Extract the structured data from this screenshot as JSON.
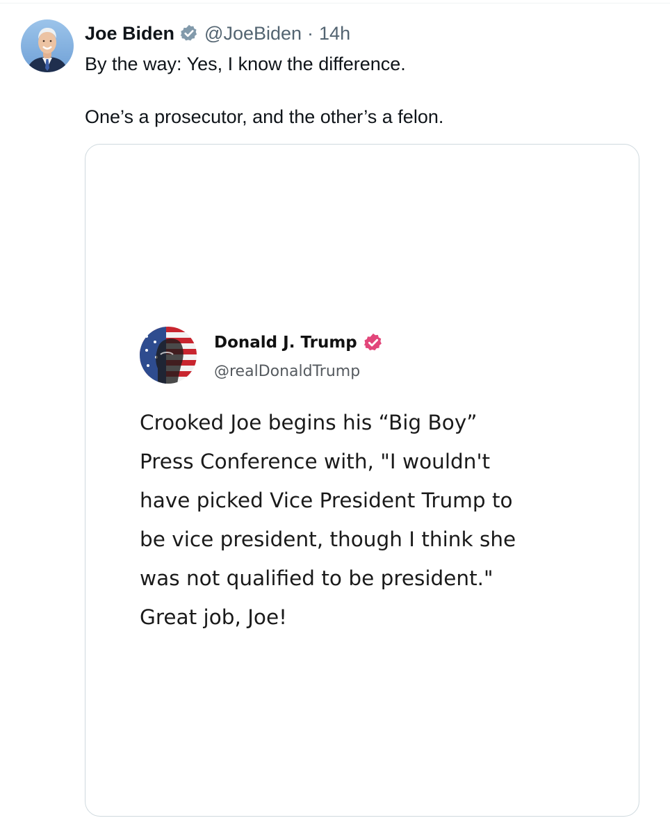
{
  "tweet": {
    "author": {
      "name": "Joe Biden",
      "handle": "@JoeBiden",
      "verified_badge_color": "#829aab",
      "avatar_icon": "joe-biden-avatar"
    },
    "separator": "·",
    "timestamp": "14h",
    "text_line_1": "By the way: Yes, I know the difference.",
    "text_line_2": "One’s a prosecutor, and the other’s a felon."
  },
  "embedded_post": {
    "author": {
      "name": "Donald J. Trump",
      "handle": "@realDonaldTrump",
      "verified_badge_color": "#e2467a",
      "avatar_icon": "donald-trump-flag-avatar"
    },
    "text": "Crooked Joe begins his “Big Boy”\nPress Conference with, \"I wouldn't\nhave picked Vice President Trump to\nbe vice president, though I think she\nwas not qualified to be president.\"\nGreat job, Joe!"
  },
  "colors": {
    "text_primary": "#0f1419",
    "text_secondary": "#536471",
    "card_border": "#cfd9de"
  }
}
